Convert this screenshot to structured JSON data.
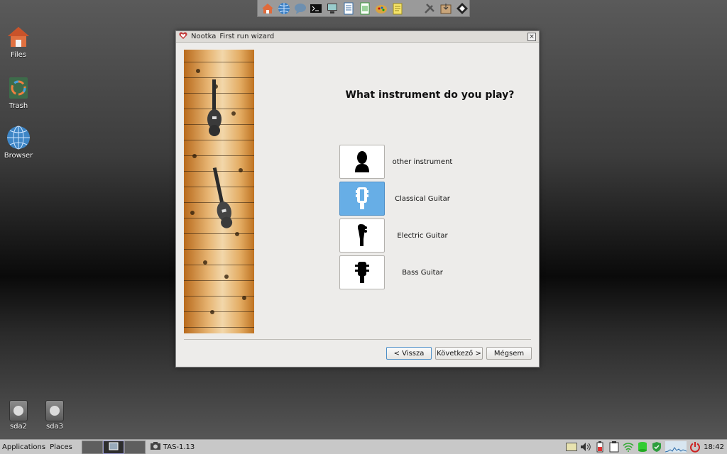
{
  "top_dock": {
    "icons": [
      "home-icon",
      "globe-icon",
      "chat-icon",
      "terminal-icon",
      "computer-icon",
      "document-icon",
      "spreadsheet-icon",
      "paint-icon",
      "notepad-icon",
      "tools-icon",
      "install-icon",
      "package-icon"
    ]
  },
  "desktop": {
    "files_label": "Files",
    "trash_label": "Trash",
    "browser_label": "Browser"
  },
  "dialog": {
    "app_name": "Nootka",
    "window_title": "First run wizard",
    "close_symbol": "×",
    "question": "What instrument do you play?",
    "choices": [
      {
        "label": "other instrument",
        "icon": "person-silhouette-icon",
        "selected": false
      },
      {
        "label": "Classical Guitar",
        "icon": "classical-headstock-icon",
        "selected": true
      },
      {
        "label": "Electric Guitar",
        "icon": "electric-headstock-icon",
        "selected": false
      },
      {
        "label": "Bass Guitar",
        "icon": "bass-headstock-icon",
        "selected": false
      }
    ],
    "back_label": "< Vissza",
    "next_label": "Következő >",
    "cancel_label": "Mégsem"
  },
  "drives": {
    "sda2_label": "sda2",
    "sda3_label": "sda3"
  },
  "taskbar": {
    "applications_label": "Applications",
    "places_label": "Places",
    "task_label": "TAS-1.13",
    "clock": "18:42"
  },
  "colors": {
    "selected_choice": "#67aee6",
    "dialog_bg": "#edecea",
    "taskbar_bg": "#c8c8c8"
  }
}
